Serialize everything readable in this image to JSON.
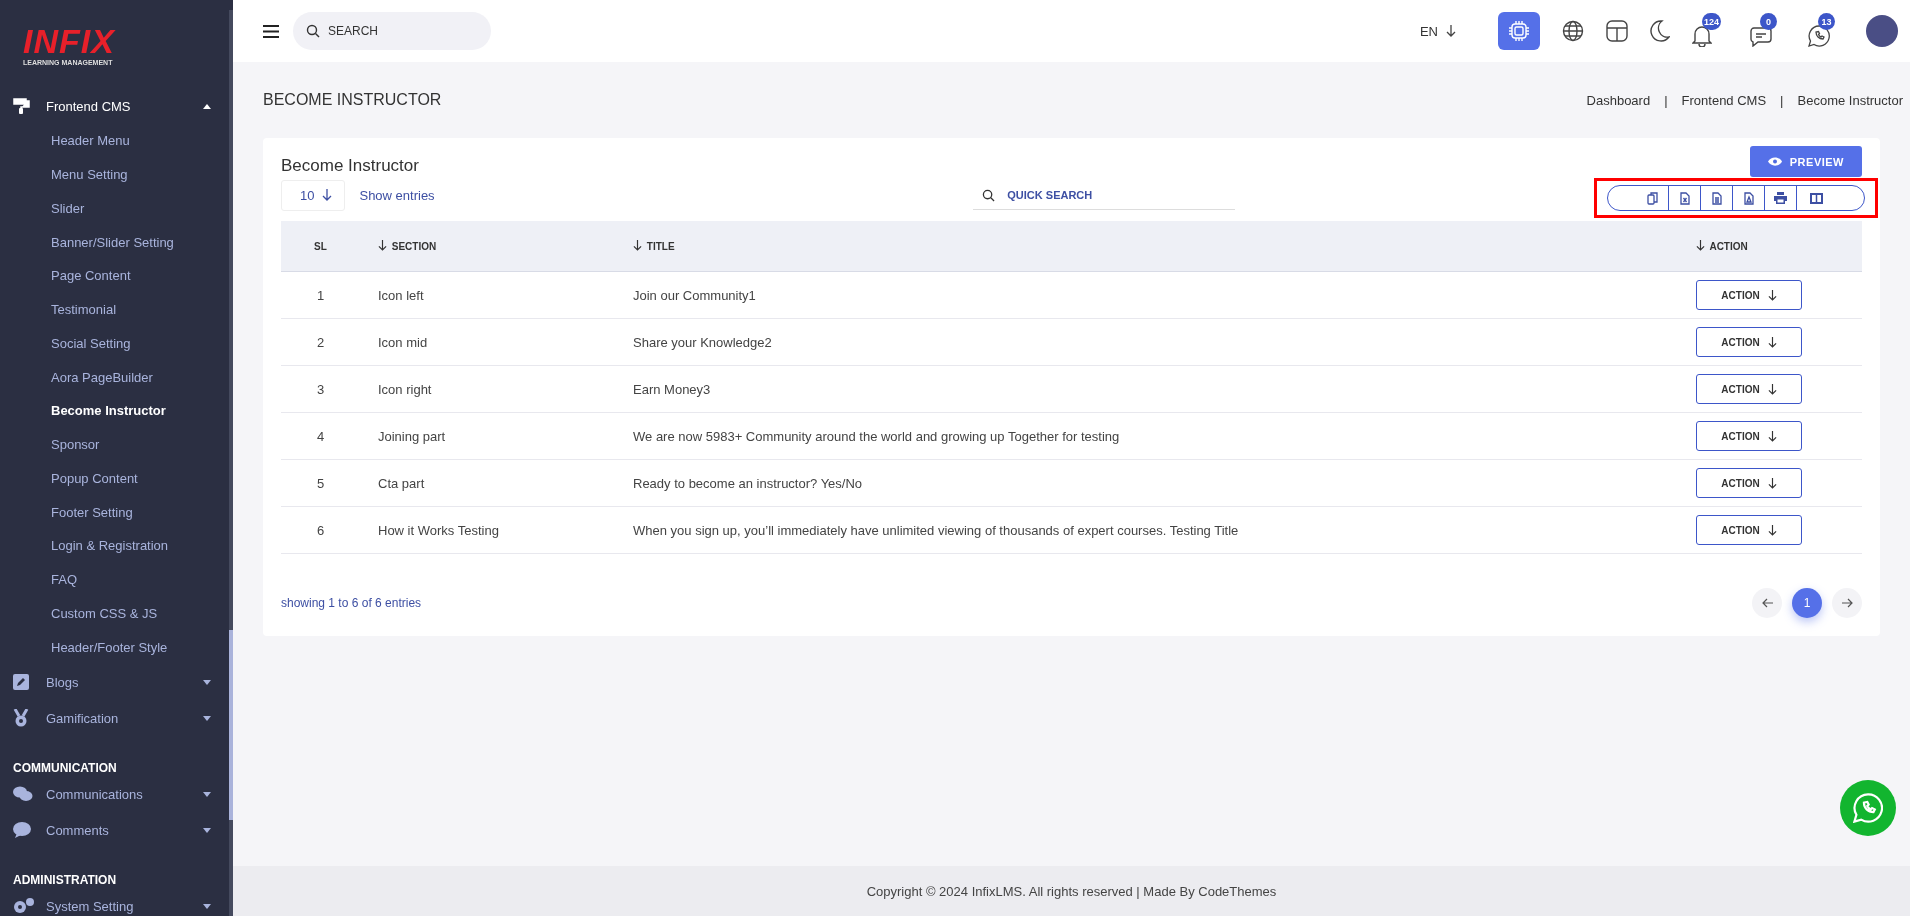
{
  "sidebar": {
    "logo": {
      "name": "INFIX",
      "tagline": "LEARNING MANAGEMENT"
    },
    "nav": [
      {
        "kind": "group",
        "label": "Frontend CMS",
        "expanded": true,
        "children": [
          {
            "label": "Header Menu",
            "selected": false
          },
          {
            "label": "Menu Setting",
            "selected": false
          },
          {
            "label": "Slider",
            "selected": false
          },
          {
            "label": "Banner/Slider Setting",
            "selected": false
          },
          {
            "label": "Page Content",
            "selected": false
          },
          {
            "label": "Testimonial",
            "selected": false
          },
          {
            "label": "Social Setting",
            "selected": false
          },
          {
            "label": "Aora PageBuilder",
            "selected": false
          },
          {
            "label": "Become Instructor",
            "selected": true
          },
          {
            "label": "Sponsor",
            "selected": false
          },
          {
            "label": "Popup Content",
            "selected": false
          },
          {
            "label": "Footer Setting",
            "selected": false
          },
          {
            "label": "Login & Registration",
            "selected": false
          },
          {
            "label": "FAQ",
            "selected": false
          },
          {
            "label": "Custom CSS & JS",
            "selected": false
          },
          {
            "label": "Header/Footer Style",
            "selected": false
          }
        ]
      },
      {
        "kind": "group",
        "label": "Blogs",
        "expanded": false
      },
      {
        "kind": "group",
        "label": "Gamification",
        "expanded": false
      },
      {
        "kind": "heading",
        "label": "COMMUNICATION"
      },
      {
        "kind": "group",
        "label": "Communications",
        "expanded": false
      },
      {
        "kind": "group",
        "label": "Comments",
        "expanded": false
      },
      {
        "kind": "heading",
        "label": "ADMINISTRATION"
      },
      {
        "kind": "group",
        "label": "System Setting",
        "expanded": false
      }
    ]
  },
  "topbar": {
    "search": {
      "placeholder": "SEARCH"
    },
    "language": "EN",
    "ai_button": {
      "active": true
    },
    "notifications": [
      {
        "count": "124"
      },
      {
        "count": "0"
      },
      {
        "count": "13"
      }
    ]
  },
  "page": {
    "title": "BECOME INSTRUCTOR",
    "breadcrumb_separator": "|",
    "breadcrumbs": [
      {
        "label": "Dashboard"
      },
      {
        "label": "Frontend CMS"
      },
      {
        "label": "Become Instructor"
      }
    ]
  },
  "card": {
    "title": "Become Instructor",
    "preview_button": "PREVIEW",
    "page_size": "10",
    "show_entries": "Show entries",
    "quick_search": {
      "placeholder": "QUICK SEARCH"
    },
    "table": {
      "columns": [
        {
          "label": "SL",
          "sortable": false
        },
        {
          "label": "SECTION",
          "sortable": true
        },
        {
          "label": "TITLE",
          "sortable": true
        },
        {
          "label": "ACTION",
          "sortable": true
        }
      ],
      "rows": [
        {
          "sl": "1",
          "section": "Icon left",
          "title": "Join our Community1",
          "action": "ACTION"
        },
        {
          "sl": "2",
          "section": "Icon mid",
          "title": "Share your Knowledge2",
          "action": "ACTION"
        },
        {
          "sl": "3",
          "section": "Icon right",
          "title": "Earn Money3",
          "action": "ACTION"
        },
        {
          "sl": "4",
          "section": "Joining part",
          "title": "We are now 5983+ Community around the world and growing up Together for testing",
          "action": "ACTION"
        },
        {
          "sl": "5",
          "section": "Cta part",
          "title": "Ready to become an instructor? Yes/No",
          "action": "ACTION"
        },
        {
          "sl": "6",
          "section": "How it Works Testing",
          "title": "When you sign up, you’ll immediately have unlimited viewing of thousands of expert courses. Testing Title",
          "action": "ACTION"
        }
      ]
    },
    "summary": "showing 1 to 6 of 6 entries",
    "pagination": {
      "pages": [
        {
          "label": "1",
          "selected": true
        }
      ]
    }
  },
  "footer": "Copyright © 2024 InfixLMS. All rights reserved | Made By CodeThemes"
}
